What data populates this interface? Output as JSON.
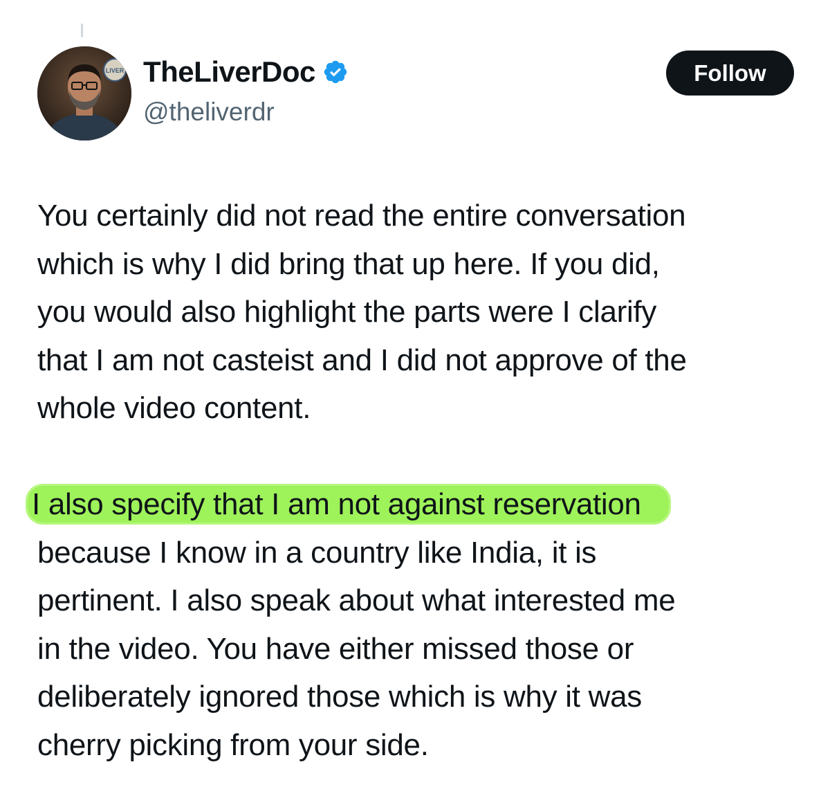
{
  "author": {
    "display_name": "TheLiverDoc",
    "handle": "@theliverdr",
    "verified": true,
    "avatar_badge_text": "LIVER"
  },
  "actions": {
    "follow_label": "Follow"
  },
  "tweet": {
    "paragraph1": [
      "You certainly did not read the entire conversation",
      "which is why I did bring that up here. If you did,",
      "you would also highlight the parts were I clarify",
      "that I am not casteist and I did not approve of the",
      "whole video content."
    ],
    "paragraph2_highlighted": "I also specify that I am not against reservation",
    "paragraph2": [
      "because I know in a country like India, it is",
      "pertinent. I also speak about what interested me",
      "in the video. You have either missed those or",
      "deliberately ignored those which is why it was",
      "cherry picking from your side."
    ]
  },
  "colors": {
    "verified_badge": "#1d9bf0",
    "highlight": "#9ef25a",
    "follow_button_bg": "#0f1419",
    "handle_text": "#536471"
  }
}
